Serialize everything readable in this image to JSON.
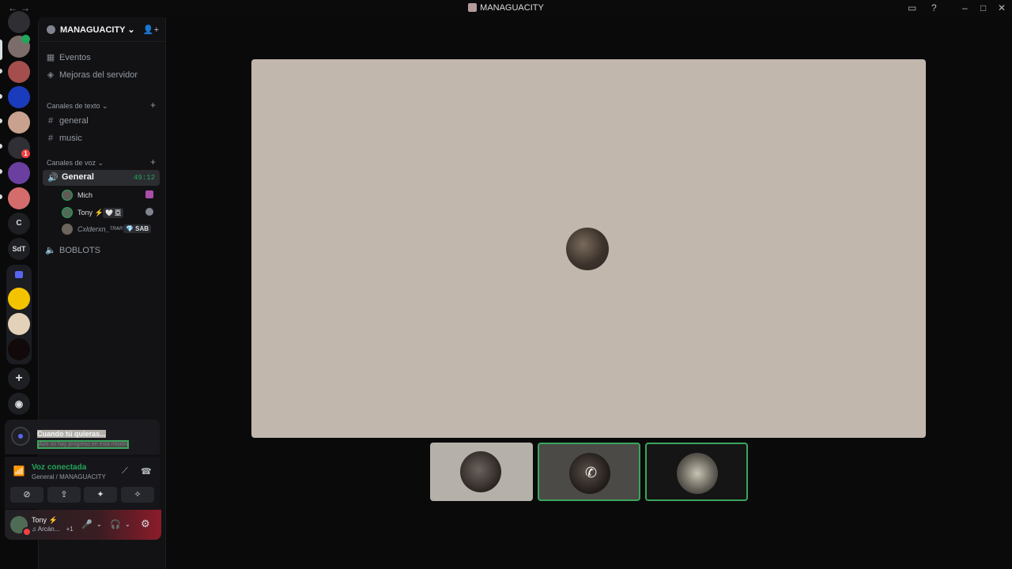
{
  "window": {
    "title": "MANAGUACITY",
    "back_label": "←",
    "forward_label": "→",
    "inbox_icon": "▭",
    "help_icon": "?",
    "minimize": "–",
    "maximize": "□",
    "close": "✕"
  },
  "servers": [
    {
      "name": "server-1",
      "color": "#7d6d6a",
      "badge": ""
    },
    {
      "name": "server-2",
      "color": "#a44e4e",
      "badge": ""
    },
    {
      "name": "server-3",
      "color": "#1b3bbd",
      "badge": ""
    },
    {
      "name": "server-4",
      "color": "#c8a28e",
      "badge": ""
    },
    {
      "name": "server-5",
      "color": "#2f2f35",
      "badge": "1"
    },
    {
      "name": "server-6",
      "color": "#6a3fa0",
      "badge": ""
    },
    {
      "name": "server-7",
      "color": "#d46c6c",
      "badge": ""
    }
  ],
  "text_servers": {
    "c": "C",
    "sdt": "SdT ⚡"
  },
  "server": {
    "name": "MANAGUACITY ⌄",
    "invite_icon": "👤+"
  },
  "nav": {
    "events": "Eventos",
    "boosts": "Mejoras del servidor"
  },
  "text_category": {
    "label": "Canales de texto ⌄",
    "add": "+",
    "channels": [
      "general",
      "music"
    ]
  },
  "voice_category": {
    "label": "Canales de voz ⌄",
    "add": "+",
    "general": {
      "name": "General",
      "timer": "49:12"
    },
    "users": [
      {
        "name": "Mich",
        "tag": ""
      },
      {
        "name": "Tony ⚡",
        "tag": "🤍 亞"
      },
      {
        "name": "Cxlderxn_ᵀᴿᴬᴿ",
        "tag": "💎 SAB"
      }
    ],
    "boblots": "BOBLOTS"
  },
  "quest": {
    "title": "Cuando tú quieras...",
    "subtitle": "Aún no hay progreso en esta misión"
  },
  "voice_panel": {
    "status": "Voz conectada",
    "location": "General / MANAGUACITY",
    "noise_icon": "⟋",
    "disconnect_icon": "☎",
    "buttons": [
      "⊘",
      "⇪",
      "✦",
      "✧"
    ]
  },
  "user": {
    "name": "Tony ⚡",
    "activity": "♫ Arcán...",
    "extra": "+1",
    "mic_icon": "🎤",
    "headphone_icon": "🎧",
    "settings_icon": "⚙"
  },
  "colors": {
    "accent_green": "#23a55a",
    "stage_bg": "#c2b7ad",
    "danger": "#f23f43"
  }
}
